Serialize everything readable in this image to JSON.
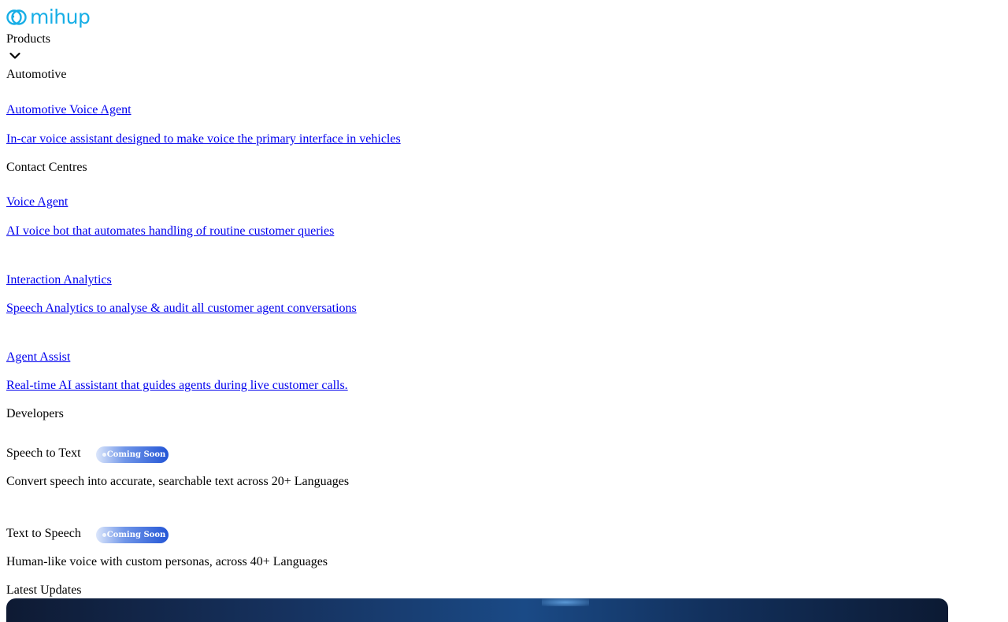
{
  "brand": {
    "name": "mihup",
    "color": "#17aee6"
  },
  "nav": {
    "products_label": "Products",
    "toggle_icon": "chevron-down-icon"
  },
  "menu": {
    "automotive": {
      "heading": "Automotive",
      "items": [
        {
          "title": "Automotive Voice Agent",
          "description": "In-car voice assistant designed to make voice the primary interface in vehicles"
        }
      ]
    },
    "contact_centres": {
      "heading": "Contact Centres",
      "items": [
        {
          "title": "Voice Agent",
          "description": "AI voice bot that automates handling of routine customer queries"
        },
        {
          "title": "Interaction Analytics",
          "description": "Speech Analytics to analyse & audit all customer agent conversations"
        },
        {
          "title": "Agent Assist",
          "description": "Real-time AI assistant that guides agents during live customer calls."
        }
      ]
    },
    "developers": {
      "heading": "Developers",
      "items": [
        {
          "title": "Speech to Text",
          "badge": "Coming Soon",
          "description": "Convert speech into accurate, searchable text across 20+ Languages"
        },
        {
          "title": "Text to Speech",
          "badge": "Coming Soon",
          "description": "Human-like voice with custom personas, across 40+ Languages"
        }
      ]
    },
    "latest_updates": {
      "heading": "Latest Updates"
    }
  },
  "colors": {
    "link": "#0000ee",
    "badge_start": "#dbe6fb",
    "badge_end": "#2456d6"
  }
}
